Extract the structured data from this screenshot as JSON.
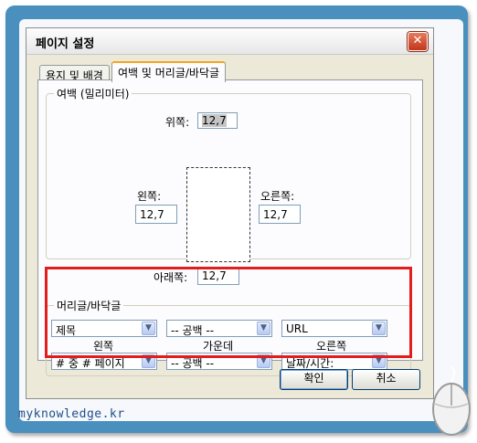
{
  "watermark": "myknowledge.kr",
  "dialog": {
    "title": "페이지 설정",
    "close_glyph": "✕"
  },
  "tabs": [
    {
      "label": "용지 및 배경",
      "active": false
    },
    {
      "label": "여백 및 머리글/바닥글",
      "active": true
    }
  ],
  "margins": {
    "legend": "여백 (밀리미터)",
    "top_label": "위쪽:",
    "top_value": "12,7",
    "left_label": "왼쪽:",
    "left_value": "12,7",
    "right_label": "오른쪽:",
    "right_value": "12,7",
    "bottom_label": "아래쪽:",
    "bottom_value": "12,7"
  },
  "header_footer": {
    "legend": "머리글/바닥글",
    "header_left": "제목",
    "header_center": "-- 공백 --",
    "header_right": "URL",
    "col_left": "왼쪽",
    "col_center": "가운데",
    "col_right": "오른쪽",
    "footer_left": "# 중 # 페이지",
    "footer_center": "-- 공백 --",
    "footer_right": "날짜/시간:"
  },
  "buttons": {
    "ok": "확인",
    "cancel": "취소"
  },
  "colors": {
    "frame": "#4a90bf",
    "highlight": "#e21d1d"
  }
}
